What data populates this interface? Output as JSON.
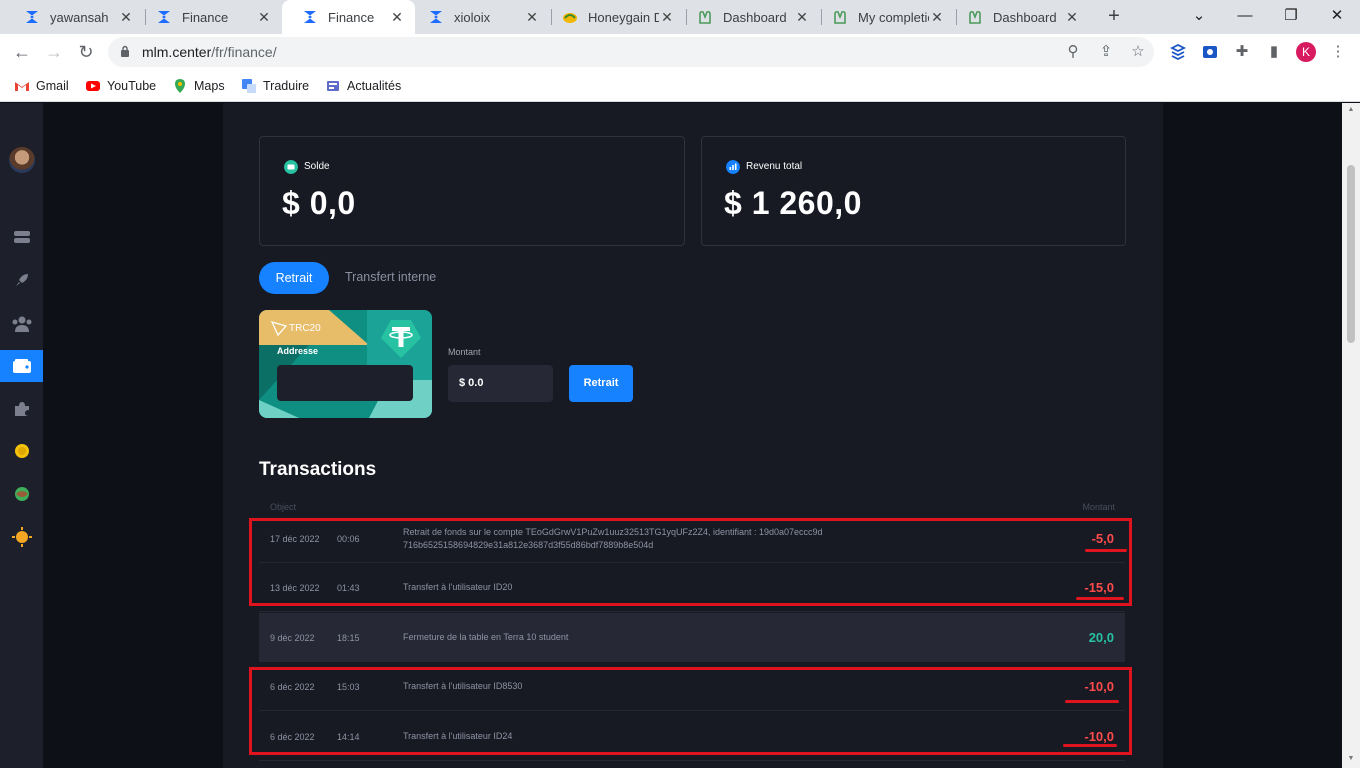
{
  "browser": {
    "tabs": [
      {
        "label": "yawansah",
        "icon": "xiolo-x-icon"
      },
      {
        "label": "Finance",
        "icon": "xiolo-x-icon"
      },
      {
        "label": "Finance",
        "icon": "xiolo-x-icon",
        "active": true
      },
      {
        "label": "xioloix",
        "icon": "xiolo-x-icon"
      },
      {
        "label": "Honeygain D",
        "icon": "honeygain-icon"
      },
      {
        "label": "Dashboard",
        "icon": "plant-icon"
      },
      {
        "label": "My completio",
        "icon": "plant-icon"
      },
      {
        "label": "Dashboard",
        "icon": "plant-icon"
      }
    ],
    "url_host": "mlm.center",
    "url_path": "/fr/finance/",
    "profile_initial": "K",
    "bookmarks": [
      {
        "label": "Gmail",
        "icon": "gmail-icon"
      },
      {
        "label": "YouTube",
        "icon": "youtube-icon"
      },
      {
        "label": "Maps",
        "icon": "maps-icon"
      },
      {
        "label": "Traduire",
        "icon": "translate-icon"
      },
      {
        "label": "Actualités",
        "icon": "news-icon"
      }
    ]
  },
  "sidebar": {
    "items": [
      "dashboard-icon",
      "rocket-icon",
      "team-icon",
      "wallet-icon",
      "puzzle-icon",
      "coin-icon",
      "globe-icon",
      "sun-icon"
    ],
    "active_index": 3
  },
  "balance": {
    "solde_label": "Solde",
    "solde_value": "$ 0,0",
    "revenu_label": "Revenu total",
    "revenu_value": "$ 1 260,0"
  },
  "tabs": {
    "retrait": "Retrait",
    "transfert": "Transfert interne"
  },
  "withdraw": {
    "network": "TRC20",
    "address_label": "Addresse",
    "amount_label": "Montant",
    "amount_value": "$ 0.0",
    "button": "Retrait"
  },
  "transactions": {
    "title": "Transactions",
    "header_object": "Object",
    "header_amount": "Montant",
    "rows": [
      {
        "date": "17 déc 2022",
        "time": "00:06",
        "object": "Retrait de fonds sur le compte TEoGdGrwV1PuZw1uuz32513TG1yqUFz2Z4, identifiant : 19d0a07eccc9d716b6525158694829e31a812e3687d3f55d86bdf7889b8e504d",
        "amount": "-5,0",
        "sign": "neg"
      },
      {
        "date": "13 déc 2022",
        "time": "01:43",
        "object": "Transfert à l'utilisateur ID20",
        "amount": "-15,0",
        "sign": "neg"
      },
      {
        "date": "9 déc 2022",
        "time": "18:15",
        "object": "Fermeture de la table en Terra 10 student",
        "amount": "20,0",
        "sign": "pos"
      },
      {
        "date": "6 déc 2022",
        "time": "15:03",
        "object": "Transfert à l'utilisateur ID8530",
        "amount": "-10,0",
        "sign": "neg"
      },
      {
        "date": "6 déc 2022",
        "time": "14:14",
        "object": "Transfert à l'utilisateur ID24",
        "amount": "-10,0",
        "sign": "neg"
      }
    ]
  },
  "colors": {
    "accent": "#1682ff",
    "negative": "#ff4b4b",
    "positive": "#26c2a2",
    "annotation": "#e0141e"
  }
}
